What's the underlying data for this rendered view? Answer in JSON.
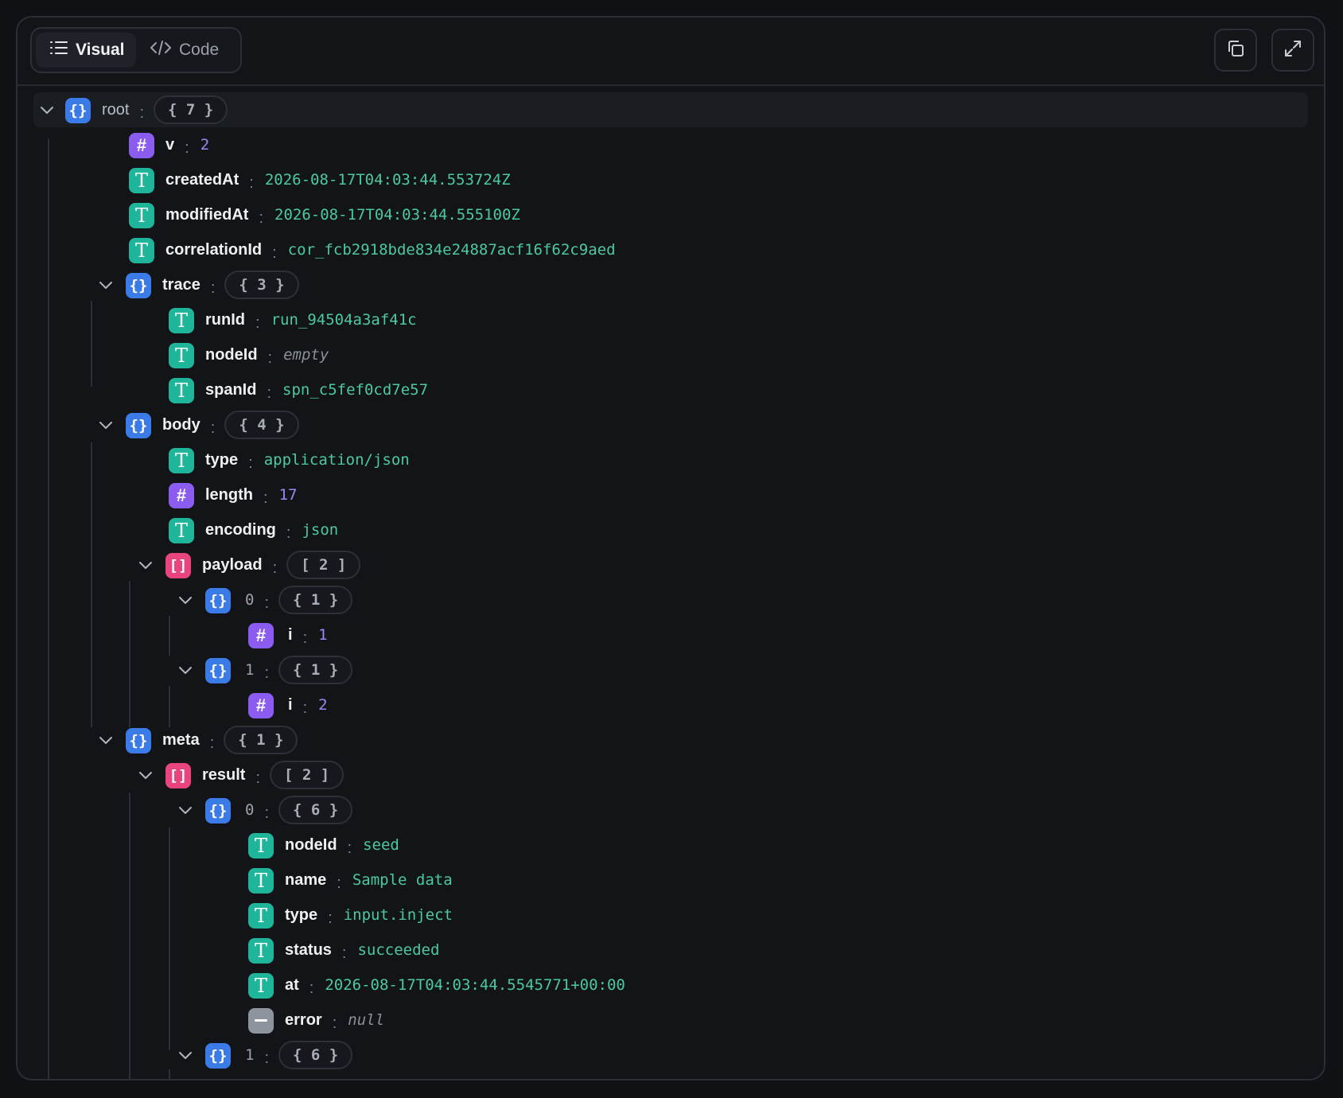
{
  "header": {
    "visual_label": "Visual",
    "code_label": "Code"
  },
  "tree": {
    "root": {
      "key": "root",
      "count": "{ 7 }"
    },
    "v": {
      "key": "v",
      "value": "2"
    },
    "createdAt": {
      "key": "createdAt",
      "value": "2026-08-17T04:03:44.553724Z"
    },
    "modifiedAt": {
      "key": "modifiedAt",
      "value": "2026-08-17T04:03:44.555100Z"
    },
    "correlationId": {
      "key": "correlationId",
      "value": "cor_fcb2918bde834e24887acf16f62c9aed"
    },
    "trace": {
      "key": "trace",
      "count": "{ 3 }",
      "runId": {
        "key": "runId",
        "value": "run_94504a3af41c"
      },
      "nodeId": {
        "key": "nodeId",
        "value": "empty"
      },
      "spanId": {
        "key": "spanId",
        "value": "spn_c5fef0cd7e57"
      }
    },
    "body": {
      "key": "body",
      "count": "{ 4 }",
      "type": {
        "key": "type",
        "value": "application/json"
      },
      "length": {
        "key": "length",
        "value": "17"
      },
      "encoding": {
        "key": "encoding",
        "value": "json"
      },
      "payload": {
        "key": "payload",
        "count": "[ 2 ]",
        "item0": {
          "key": "0",
          "count": "{ 1 }",
          "i": {
            "key": "i",
            "value": "1"
          }
        },
        "item1": {
          "key": "1",
          "count": "{ 1 }",
          "i": {
            "key": "i",
            "value": "2"
          }
        }
      }
    },
    "meta": {
      "key": "meta",
      "count": "{ 1 }",
      "result": {
        "key": "result",
        "count": "[ 2 ]",
        "item0": {
          "key": "0",
          "count": "{ 6 }",
          "nodeId": {
            "key": "nodeId",
            "value": "seed"
          },
          "name": {
            "key": "name",
            "value": "Sample data"
          },
          "type": {
            "key": "type",
            "value": "input.inject"
          },
          "status": {
            "key": "status",
            "value": "succeeded"
          },
          "at": {
            "key": "at",
            "value": "2026-08-17T04:03:44.5545771+00:00"
          },
          "error": {
            "key": "error",
            "value": "null"
          }
        },
        "item1": {
          "key": "1",
          "count": "{ 6 }"
        }
      }
    }
  }
}
